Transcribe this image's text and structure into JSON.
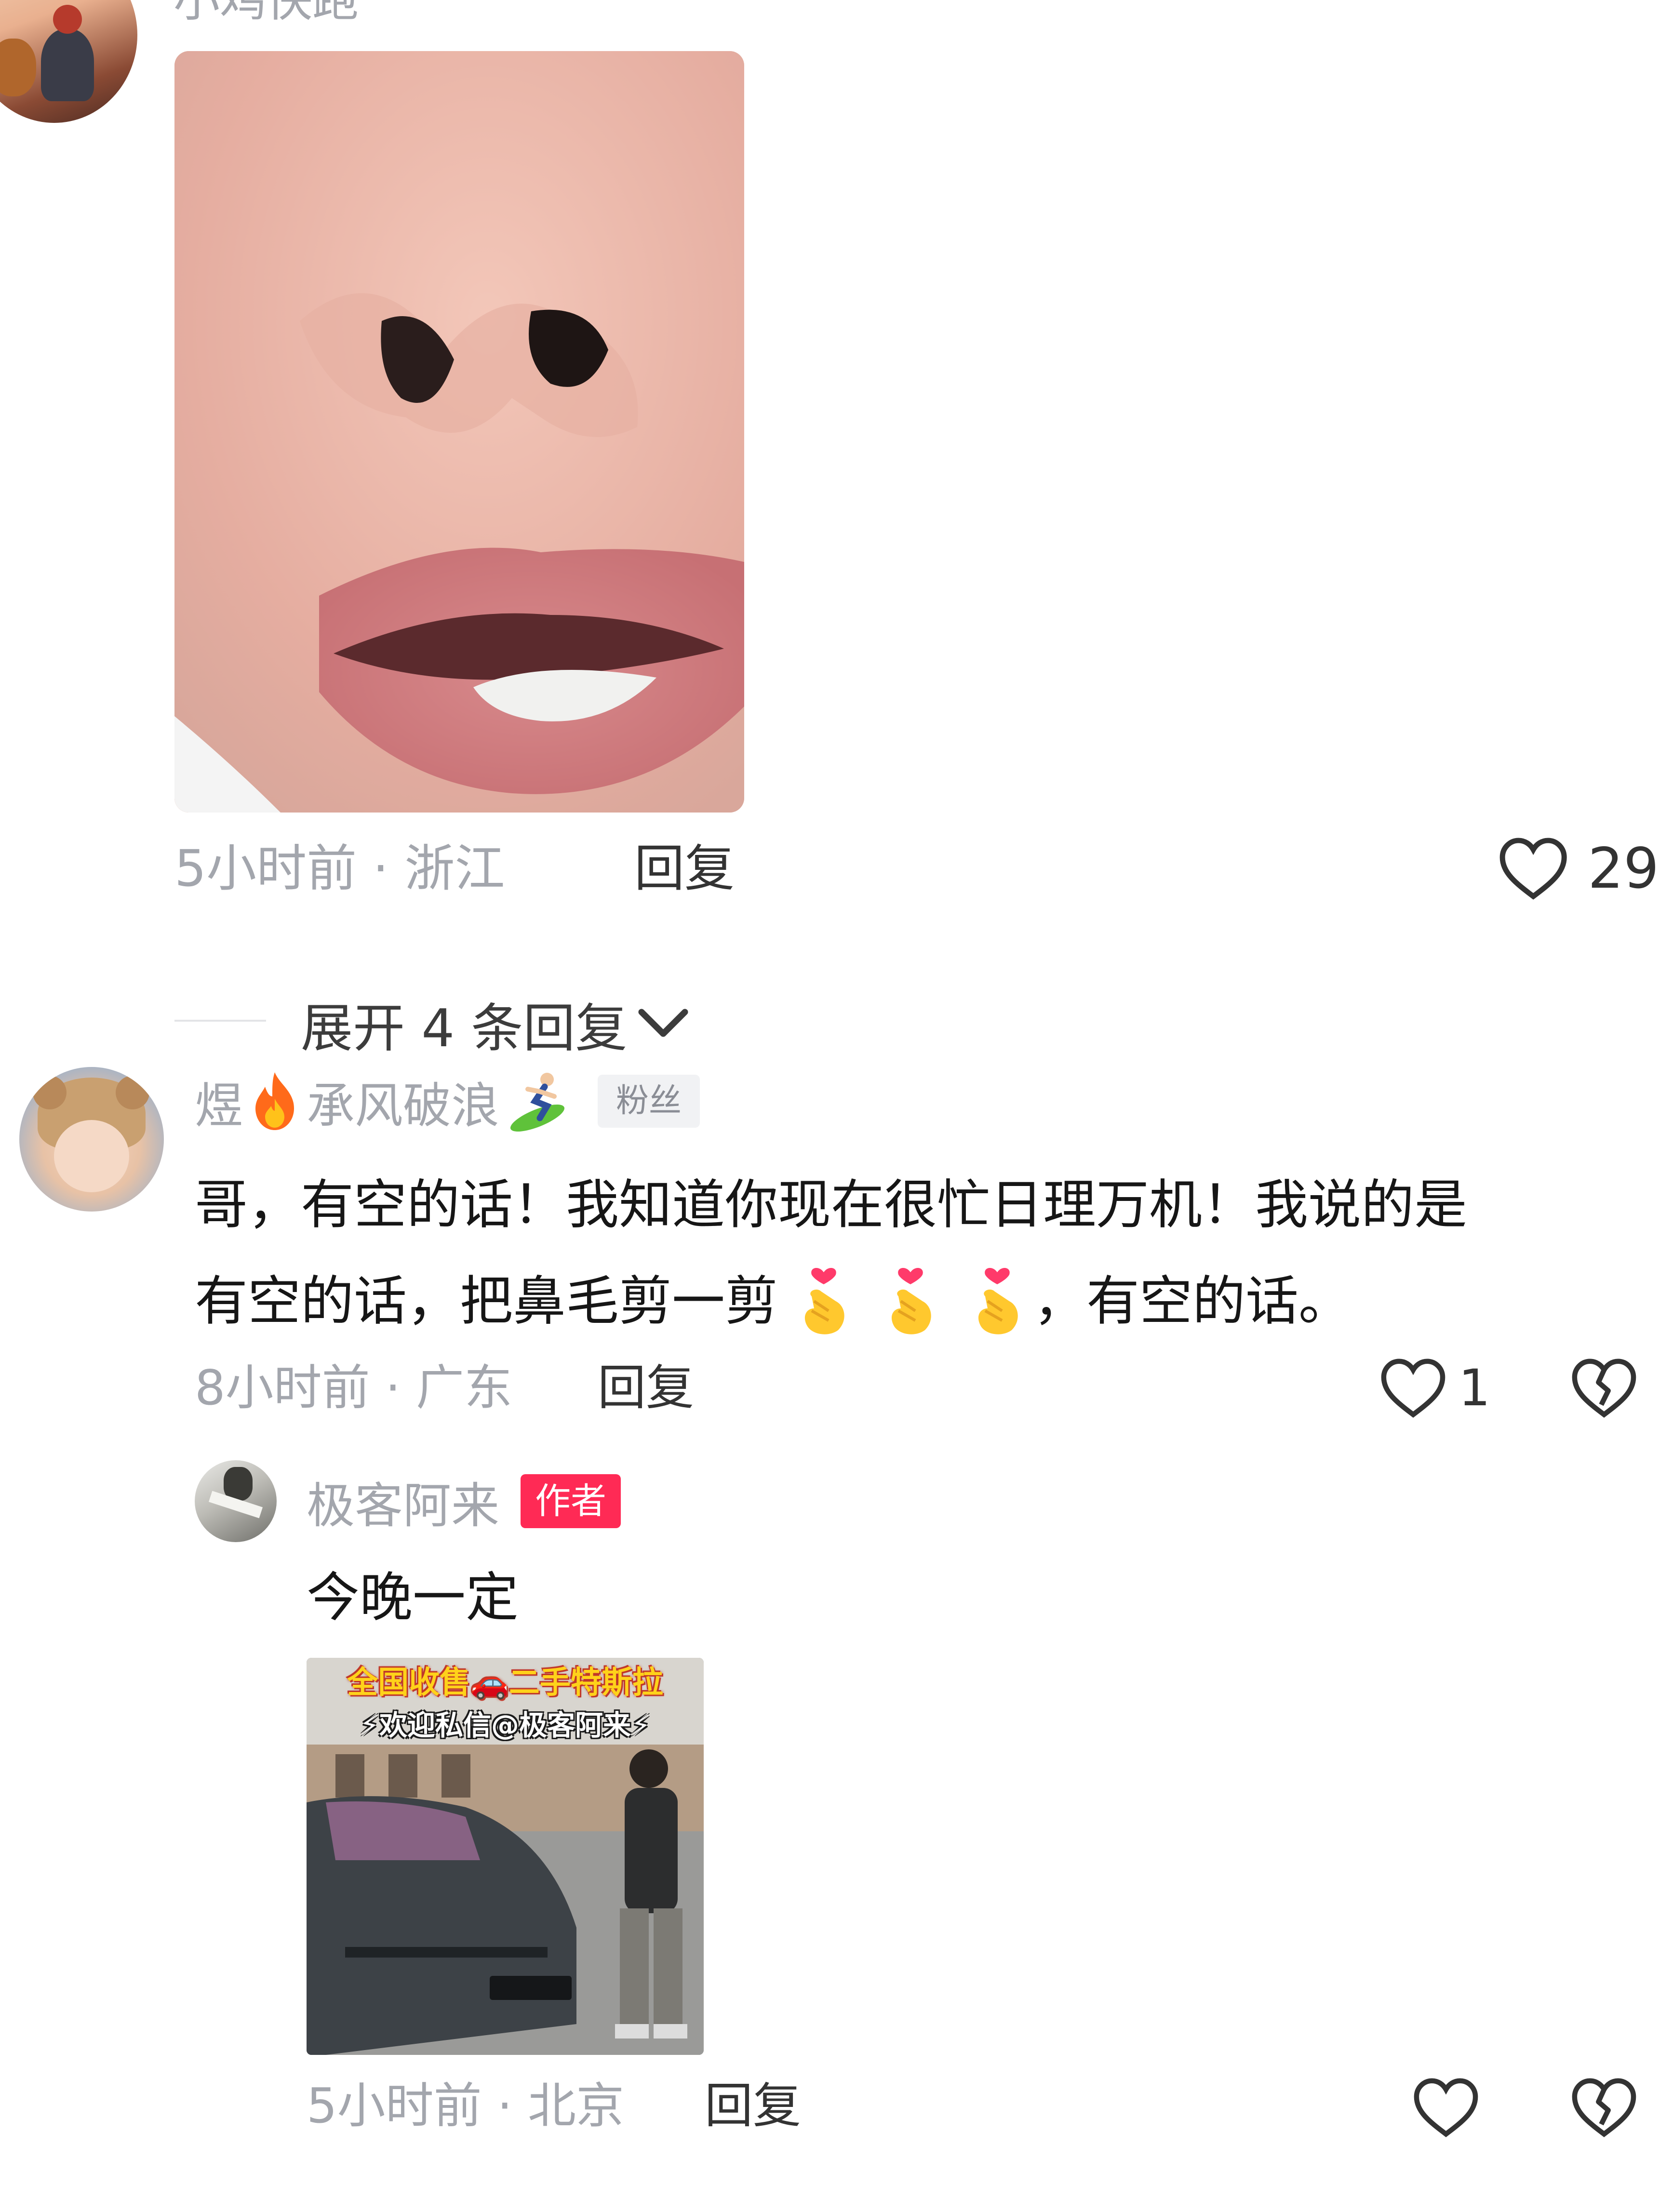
{
  "comment1": {
    "username": "小鸡快跑",
    "time_location": "5小时前 · 浙江",
    "reply_label": "回复",
    "like_count": "29"
  },
  "expand": {
    "label": "展开 4 条回复"
  },
  "comment2": {
    "username_prefix": "煜",
    "username_main": "承风破浪",
    "badge": "粉丝",
    "text_line1": "哥，有空的话！我知道你现在很忙日理万机！我说的是",
    "text_line2_a": "有空的话，把鼻毛剪一剪",
    "text_line2_b": "，有空的话。",
    "time_location": "8小时前 · 广东",
    "reply_label": "回复",
    "like_count": "1"
  },
  "reply1": {
    "username": "极客阿来",
    "badge": "作者",
    "text": "今晚一定",
    "thumb_banner_line1": "全国收售🚗二手特斯拉",
    "thumb_banner_line2": "⚡欢迎私信@极客阿来⚡",
    "time_location": "5小时前 · 北京",
    "reply_label": "回复"
  },
  "colors": {
    "meta_gray": "#a3a6ad",
    "author_badge": "#ff2a55",
    "banner_yellow": "#ffd21a"
  }
}
